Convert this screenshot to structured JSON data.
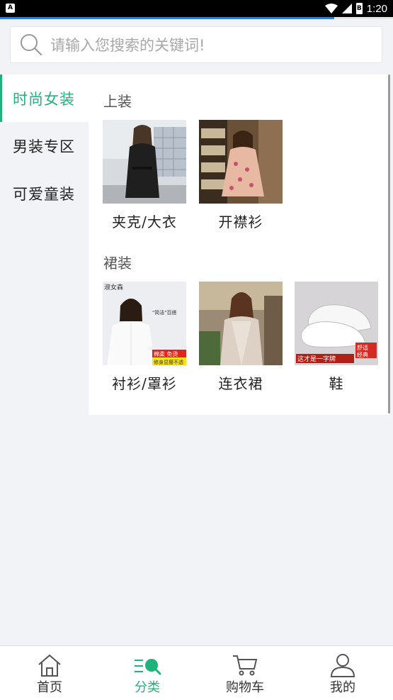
{
  "status_bar": {
    "time": "1:20",
    "battery_label": "B",
    "app_badge": "A",
    "progress_fraction": 0.85
  },
  "search": {
    "placeholder": "请输入您搜索的关键词!"
  },
  "sidebar": {
    "items": [
      {
        "label": "时尚女装",
        "active": true
      },
      {
        "label": "男装专区",
        "active": false
      },
      {
        "label": "可爱童装",
        "active": false
      }
    ]
  },
  "sections": [
    {
      "title": "上装",
      "items": [
        {
          "label": "夹克/大衣"
        },
        {
          "label": "开襟衫"
        }
      ]
    },
    {
      "title": "裙装",
      "items": [
        {
          "label": "衬衫/罩衫",
          "badge_tag": "淑女森",
          "overlay_a": "\"简洁\"百搭",
          "overlay_b": "棉柔 免烫",
          "overlay_c": "修身显瘦不透"
        },
        {
          "label": "连衣裙"
        },
        {
          "label": "鞋",
          "overlay_a": "这才是一字牌",
          "overlay_b": "舒适",
          "overlay_c": "经典"
        }
      ]
    }
  ],
  "tabbar": {
    "tabs": [
      {
        "label": "首页",
        "icon": "home-icon",
        "active": false
      },
      {
        "label": "分类",
        "icon": "category-icon",
        "active": true
      },
      {
        "label": "购物车",
        "icon": "cart-icon",
        "active": false
      },
      {
        "label": "我的",
        "icon": "user-icon",
        "active": false
      }
    ]
  },
  "colors": {
    "accent": "#20b27c",
    "text": "#222222",
    "muted": "#a8a8a8",
    "background": "#f2f3f7"
  }
}
